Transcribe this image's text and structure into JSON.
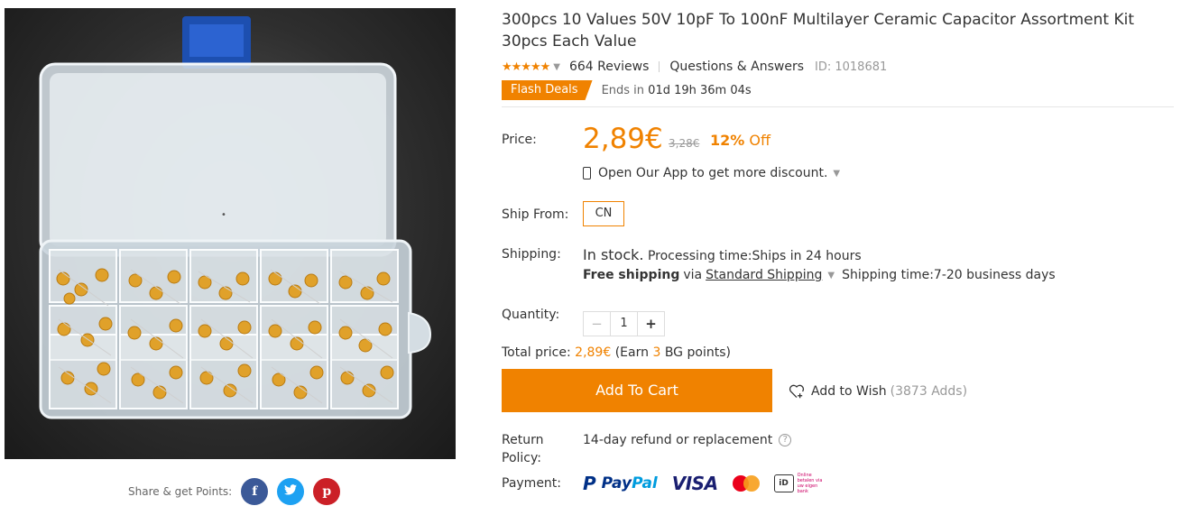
{
  "product": {
    "title": "300pcs 10 Values 50V 10pF To 100nF Multilayer Ceramic Capacitor Assortment Kit 30pcs Each Value",
    "stars": "★★★★★",
    "reviews": "664 Reviews",
    "qa": "Questions & Answers",
    "id_text": "ID: 1018681",
    "image_alt": "Capacitor assortment box"
  },
  "flash": {
    "tag": "Flash Deals",
    "ends_label": "Ends in",
    "countdown": "01d 19h 36m 04s"
  },
  "price": {
    "label": "Price:",
    "current": "2,89€",
    "original": "3,28€",
    "off_percent": "12%",
    "off_word": "Off",
    "app_promo": "Open Our App to get more discount."
  },
  "ship_from": {
    "label": "Ship From:",
    "value": "CN"
  },
  "shipping": {
    "label": "Shipping:",
    "stock": "In stock.",
    "processing": "Processing time:Ships in 24 hours",
    "free": "Free shipping",
    "via": "via",
    "method": "Standard Shipping",
    "time": "Shipping time:7-20 business days"
  },
  "quantity": {
    "label": "Quantity:",
    "minus": "−",
    "value": "1",
    "plus": "+"
  },
  "total": {
    "label": "Total price:",
    "amount": "2,89€",
    "earn_pre": "(Earn",
    "points": "3",
    "earn_post": "BG points)"
  },
  "actions": {
    "add_to_cart": "Add To Cart",
    "add_to_wish": "Add to Wish",
    "wish_count": "(3873 Adds)"
  },
  "policy": {
    "label_line1": "Return",
    "label_line2": "Policy:",
    "value": "14-day refund or replacement",
    "help": "?"
  },
  "payment": {
    "label": "Payment:",
    "paypal_1": "Pay",
    "paypal_2": "Pal",
    "visa": "VISA",
    "ideal": "iD",
    "ideal_text": "Online betalen via uw eigen bank"
  },
  "share": {
    "label": "Share & get Points:",
    "facebook": "f",
    "twitter": "t",
    "pinterest": "p"
  },
  "colors": {
    "accent": "#f08200",
    "facebook": "#3b5998",
    "twitter": "#1da1f2",
    "pinterest": "#cb2027"
  }
}
